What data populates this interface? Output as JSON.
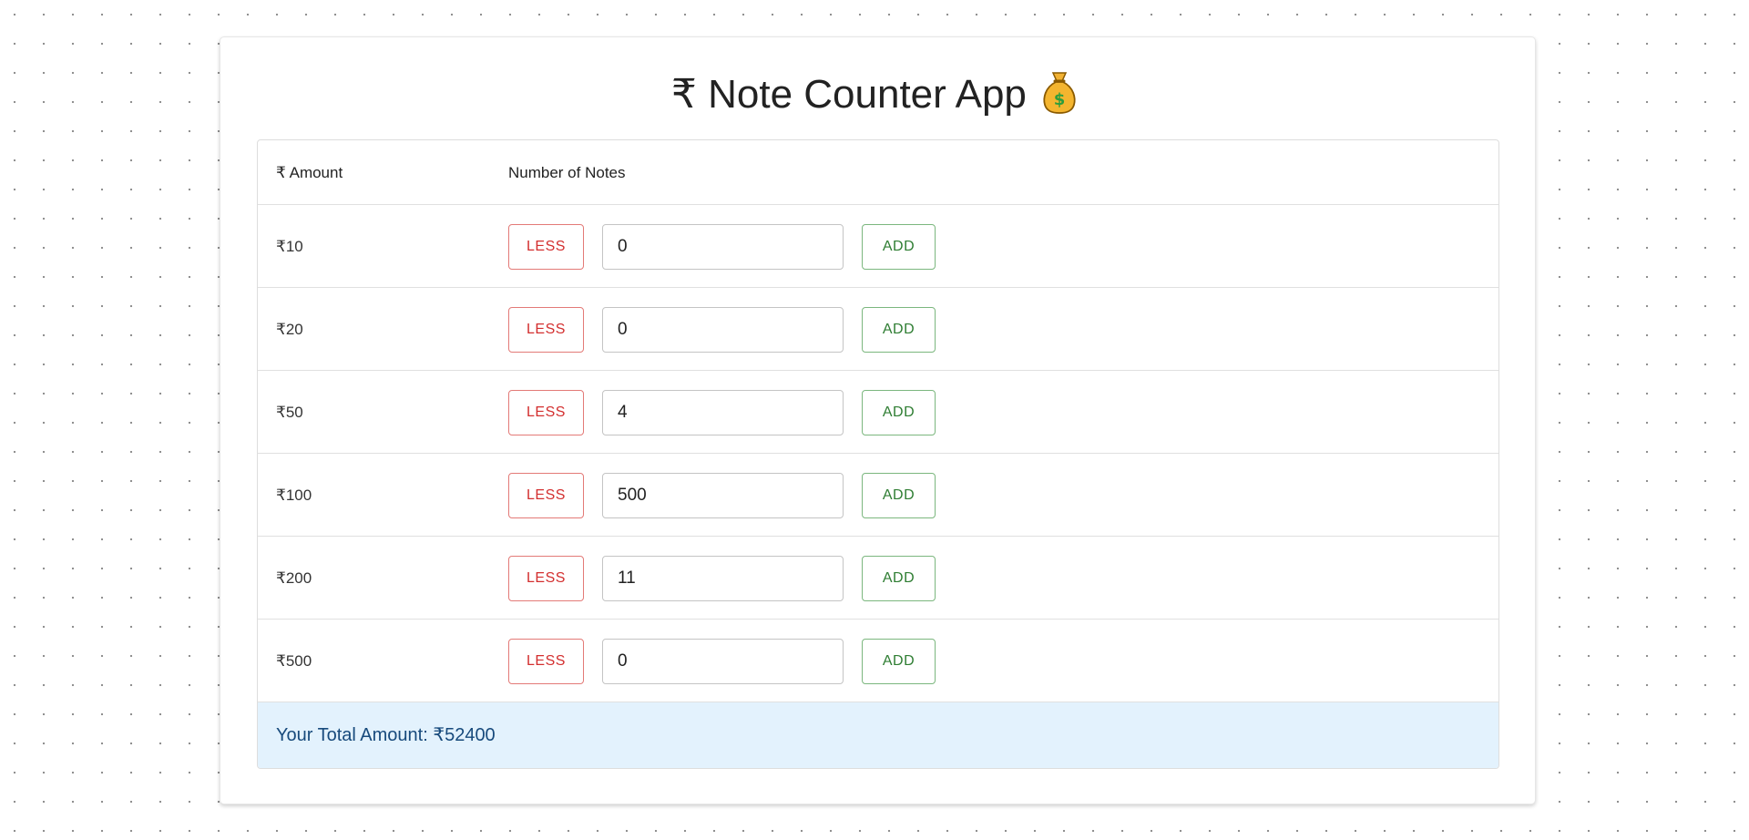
{
  "app": {
    "title": "₹ Note Counter App",
    "title_icon": "money-bag-icon"
  },
  "table": {
    "headers": {
      "amount": "₹ Amount",
      "notes": "Number of Notes"
    },
    "rows": [
      {
        "amount": "₹10",
        "count": "0"
      },
      {
        "amount": "₹20",
        "count": "0"
      },
      {
        "amount": "₹50",
        "count": "4"
      },
      {
        "amount": "₹100",
        "count": "500"
      },
      {
        "amount": "₹200",
        "count": "11"
      },
      {
        "amount": "₹500",
        "count": "0"
      }
    ]
  },
  "buttons": {
    "less_label": "LESS",
    "add_label": "ADD"
  },
  "total": {
    "text": "Your Total Amount: ₹52400"
  },
  "colors": {
    "less": "#d32f2f",
    "add": "#2e7d32",
    "total_bg": "#e3f2fd",
    "total_text": "#174a7c"
  }
}
